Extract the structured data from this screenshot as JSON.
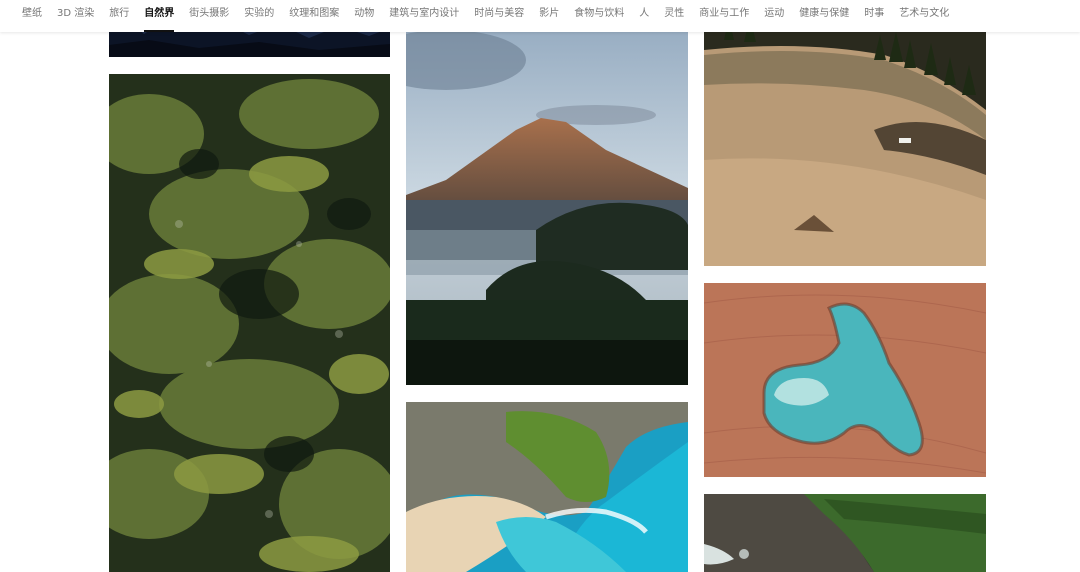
{
  "nav": {
    "items": [
      {
        "label": "壁纸",
        "active": false
      },
      {
        "label": "3D 渲染",
        "active": false
      },
      {
        "label": "旅行",
        "active": false
      },
      {
        "label": "自然界",
        "active": true
      },
      {
        "label": "街头摄影",
        "active": false
      },
      {
        "label": "实验的",
        "active": false
      },
      {
        "label": "纹理和图案",
        "active": false
      },
      {
        "label": "动物",
        "active": false
      },
      {
        "label": "建筑与室内设计",
        "active": false
      },
      {
        "label": "时尚与美容",
        "active": false
      },
      {
        "label": "影片",
        "active": false
      },
      {
        "label": "食物与饮料",
        "active": false
      },
      {
        "label": "人",
        "active": false
      },
      {
        "label": "灵性",
        "active": false
      },
      {
        "label": "商业与工作",
        "active": false
      },
      {
        "label": "运动",
        "active": false
      },
      {
        "label": "健康与保健",
        "active": false
      },
      {
        "label": "时事",
        "active": false
      },
      {
        "label": "艺术与文化",
        "active": false
      }
    ]
  },
  "gallery": {
    "photos": [
      {
        "name": "photo-night-forest-partial",
        "subject": "night forest"
      },
      {
        "name": "photo-cedar-branches",
        "subject": "cedar branches"
      },
      {
        "name": "photo-volcano-misty-valley",
        "subject": "volcano over misty valley"
      },
      {
        "name": "photo-coastal-cove-turquoise",
        "subject": "coastal cove"
      },
      {
        "name": "photo-grassy-hillside",
        "subject": "grassy hillside"
      },
      {
        "name": "photo-turquoise-lake-aerial",
        "subject": "turquoise lake in red desert"
      },
      {
        "name": "photo-coastline-rocks-partial",
        "subject": "rocky coastline"
      }
    ]
  },
  "colors": {
    "nav_text": "#767676",
    "nav_active": "#111111",
    "background": "#ffffff"
  }
}
